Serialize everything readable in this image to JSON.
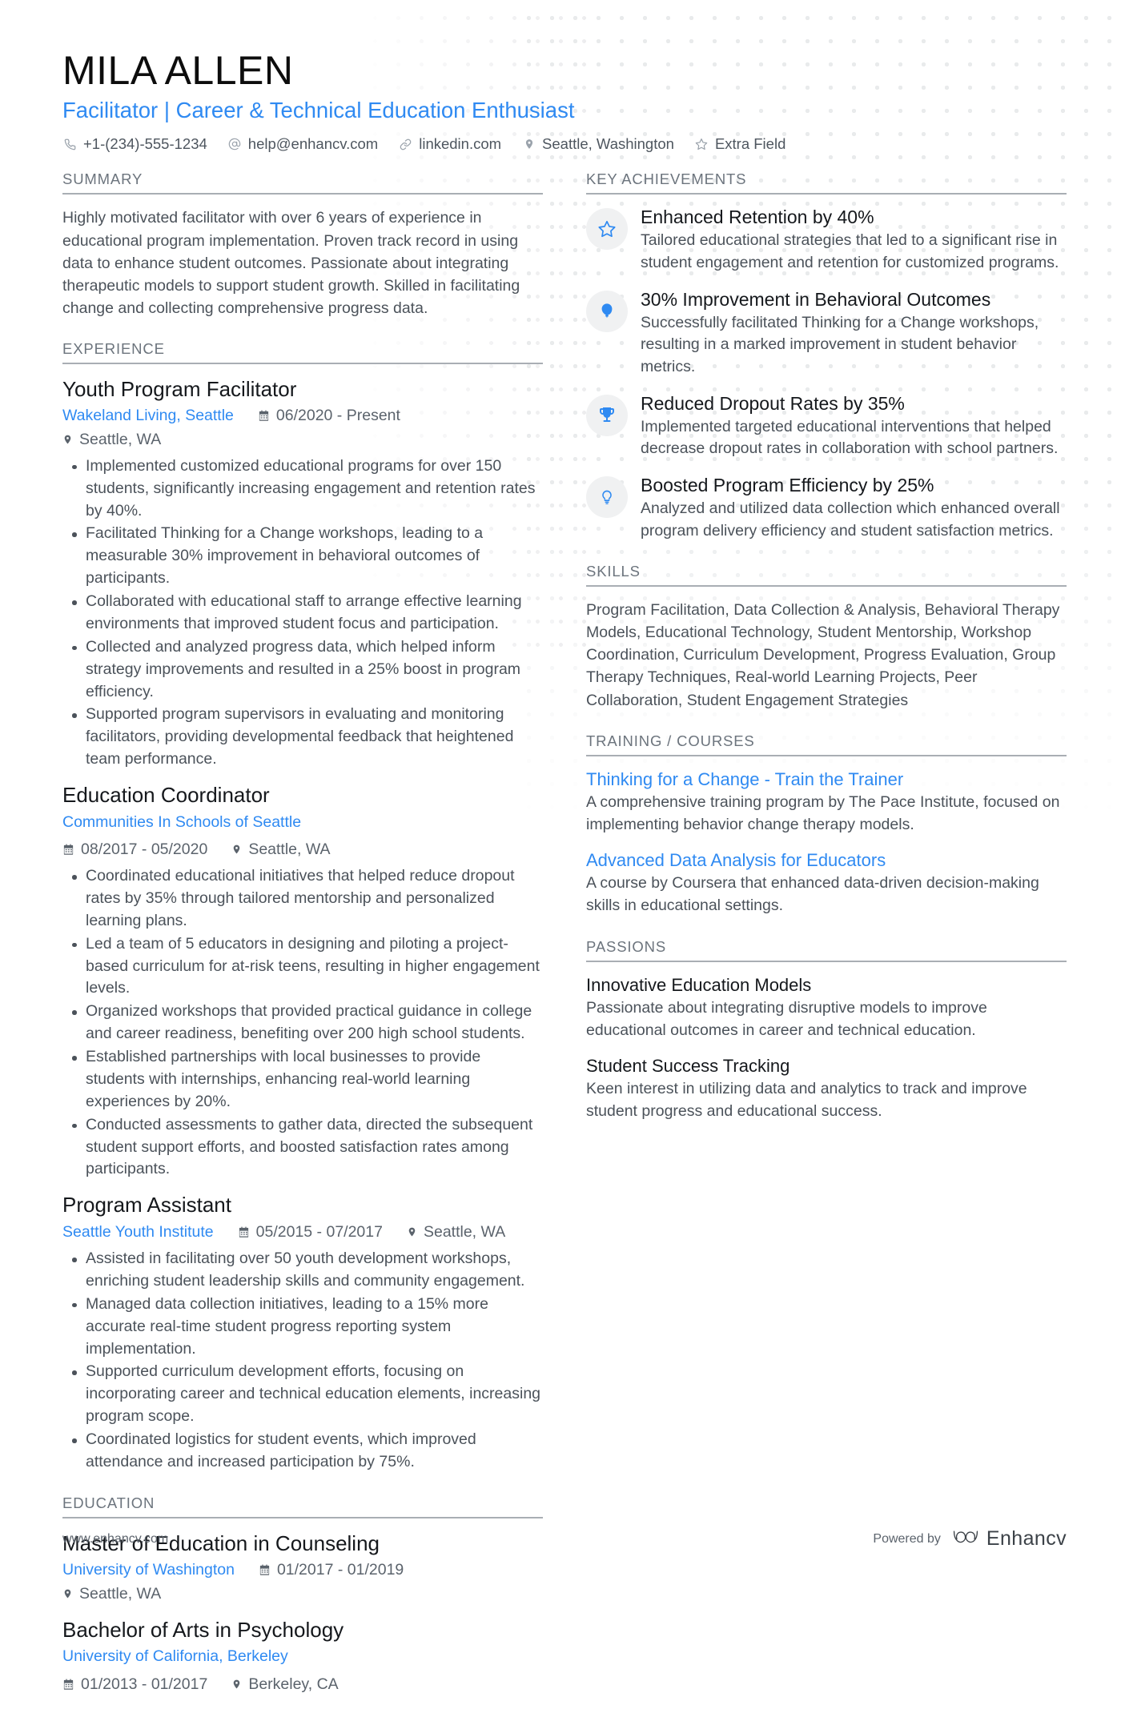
{
  "colors": {
    "accent": "#2f8af2",
    "heading_dark": "#15181c",
    "body": "#4b525a",
    "section_label": "#6c747d",
    "rule": "#a9aeb4",
    "icon_circle_bg": "#f0f1f2"
  },
  "header": {
    "name": "MILA ALLEN",
    "headline": "Facilitator | Career & Technical Education Enthusiast",
    "contacts": [
      {
        "icon": "phone-icon",
        "text": "+1-(234)-555-1234"
      },
      {
        "icon": "email-icon",
        "text": "help@enhancv.com"
      },
      {
        "icon": "link-icon",
        "text": "linkedin.com"
      },
      {
        "icon": "location-pin-icon",
        "text": "Seattle, Washington"
      },
      {
        "icon": "star-outline-icon",
        "text": "Extra Field"
      }
    ]
  },
  "left": {
    "summary": {
      "title": "SUMMARY",
      "text": "Highly motivated facilitator with over 6 years of experience in educational program implementation. Proven track record in using data to enhance student outcomes. Passionate about integrating therapeutic models to support student growth. Skilled in facilitating change and collecting comprehensive progress data."
    },
    "experience": {
      "title": "EXPERIENCE",
      "entries": [
        {
          "role": "Youth Program Facilitator",
          "company": "Wakeland Living, Seattle",
          "dates": "06/2020 - Present",
          "location": "Seattle, WA",
          "meta_layout": "inline",
          "bullets": [
            "Implemented customized educational programs for over 150 students, significantly increasing engagement and retention rates by 40%.",
            "Facilitated Thinking for a Change workshops, leading to a measurable 30% improvement in behavioral outcomes of participants.",
            "Collaborated with educational staff to arrange effective learning environments that improved student focus and participation.",
            "Collected and analyzed progress data, which helped inform strategy improvements and resulted in a 25% boost in program efficiency.",
            "Supported program supervisors in evaluating and monitoring facilitators, providing developmental feedback that heightened team performance."
          ]
        },
        {
          "role": "Education Coordinator",
          "company": "Communities In Schools of Seattle",
          "dates": "08/2017 - 05/2020",
          "location": "Seattle, WA",
          "meta_layout": "stacked",
          "bullets": [
            "Coordinated educational initiatives that helped reduce dropout rates by 35% through tailored mentorship and personalized learning plans.",
            "Led a team of 5 educators in designing and piloting a project-based curriculum for at-risk teens, resulting in higher engagement levels.",
            "Organized workshops that provided practical guidance in college and career readiness, benefiting over 200 high school students.",
            "Established partnerships with local businesses to provide students with internships, enhancing real-world learning experiences by 20%.",
            "Conducted assessments to gather data, directed the subsequent student support efforts, and boosted satisfaction rates among participants."
          ]
        },
        {
          "role": "Program Assistant",
          "company": "Seattle Youth Institute",
          "dates": "05/2015 - 07/2017",
          "location": "Seattle, WA",
          "meta_layout": "inline",
          "bullets": [
            "Assisted in facilitating over 50 youth development workshops, enriching student leadership skills and community engagement.",
            "Managed data collection initiatives, leading to a 15% more accurate real-time student progress reporting system implementation.",
            "Supported curriculum development efforts, focusing on incorporating career and technical education elements, increasing program scope.",
            "Coordinated logistics for student events, which improved attendance and increased participation by 75%."
          ]
        }
      ]
    },
    "education": {
      "title": "EDUCATION",
      "entries": [
        {
          "degree": "Master of Education in Counseling",
          "school": "University of Washington",
          "dates": "01/2017 - 01/2019",
          "location": "Seattle, WA",
          "meta_layout": "inline"
        },
        {
          "degree": "Bachelor of Arts in Psychology",
          "school": "University of California, Berkeley",
          "dates": "01/2013 - 01/2017",
          "location": "Berkeley, CA",
          "meta_layout": "stacked"
        }
      ]
    }
  },
  "right": {
    "achievements": {
      "title": "KEY ACHIEVEMENTS",
      "items": [
        {
          "icon": "star-outline-icon",
          "title": "Enhanced Retention by 40%",
          "desc": "Tailored educational strategies that led to a significant rise in student engagement and retention for customized programs."
        },
        {
          "icon": "balloon-icon",
          "title": "30% Improvement in Behavioral Outcomes",
          "desc": "Successfully facilitated Thinking for a Change workshops, resulting in a marked improvement in student behavior metrics."
        },
        {
          "icon": "trophy-icon",
          "title": "Reduced Dropout Rates by 35%",
          "desc": "Implemented targeted educational interventions that helped decrease dropout rates in collaboration with school partners."
        },
        {
          "icon": "lightbulb-icon",
          "title": "Boosted Program Efficiency by 25%",
          "desc": "Analyzed and utilized data collection which enhanced overall program delivery efficiency and student satisfaction metrics."
        }
      ]
    },
    "skills": {
      "title": "SKILLS",
      "text": "Program Facilitation, Data Collection & Analysis, Behavioral Therapy Models, Educational Technology, Student Mentorship, Workshop Coordination, Curriculum Development, Progress Evaluation, Group Therapy Techniques, Real-world Learning Projects, Peer Collaboration, Student Engagement Strategies"
    },
    "training": {
      "title": "TRAINING / COURSES",
      "items": [
        {
          "title": "Thinking for a Change - Train the Trainer",
          "desc": "A comprehensive training program by The Pace Institute, focused on implementing behavior change therapy models."
        },
        {
          "title": "Advanced Data Analysis for Educators",
          "desc": "A course by Coursera that enhanced data-driven decision-making skills in educational settings."
        }
      ]
    },
    "passions": {
      "title": "PASSIONS",
      "items": [
        {
          "title": "Innovative Education Models",
          "desc": "Passionate about integrating disruptive models to improve educational outcomes in career and technical education."
        },
        {
          "title": "Student Success Tracking",
          "desc": "Keen interest in utilizing data and analytics to track and improve student progress and educational success."
        }
      ]
    }
  },
  "footer": {
    "url": "www.enhancv.com",
    "powered_by": "Powered by",
    "brand": "Enhancv"
  }
}
